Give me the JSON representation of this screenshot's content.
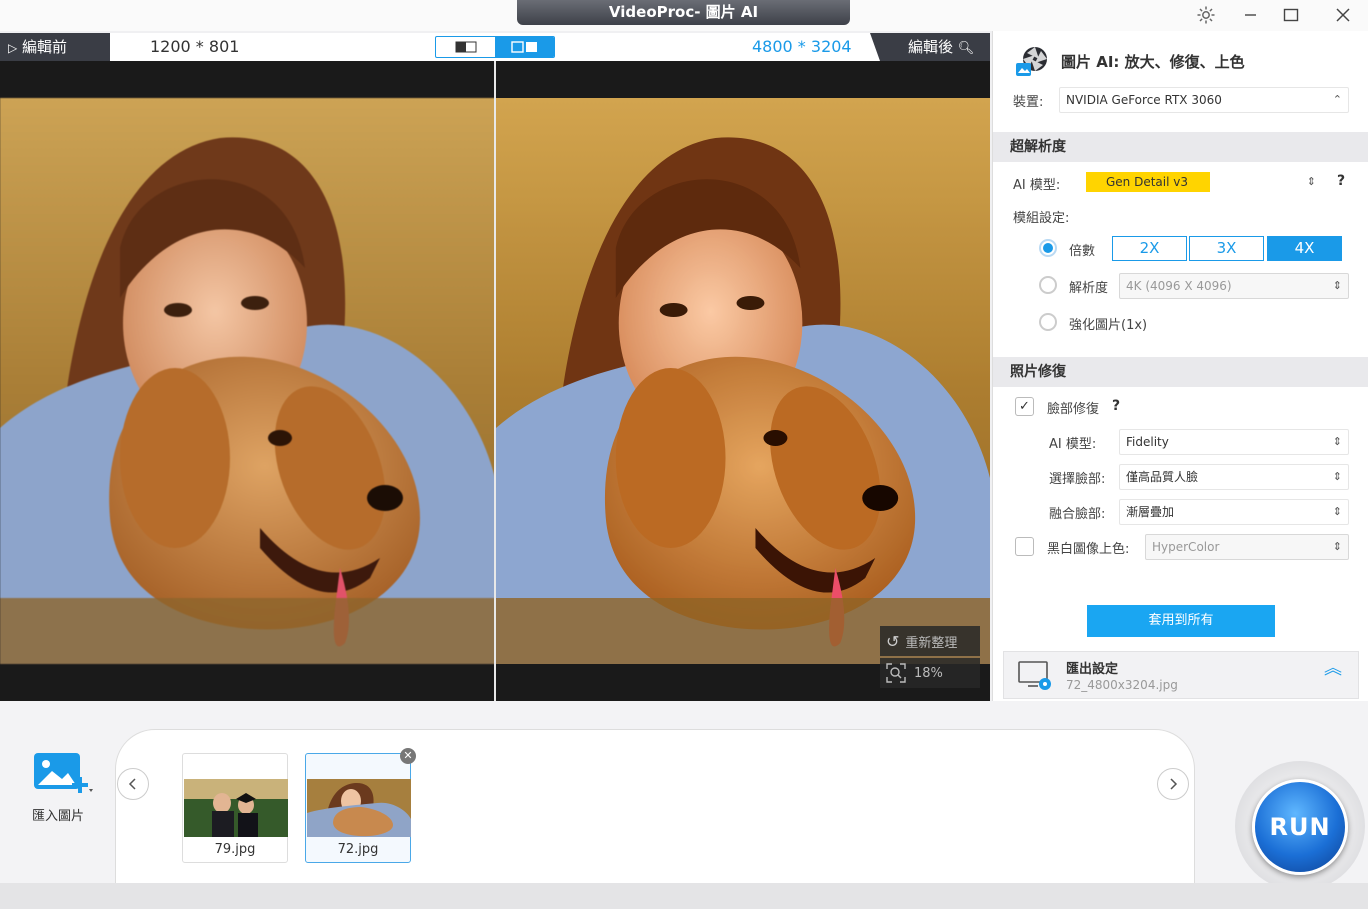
{
  "window": {
    "title": "VideoProc- 圖片 AI"
  },
  "compare": {
    "before_label": "編輯前",
    "after_label": "編輯後",
    "before_resolution": "1200 * 801",
    "after_resolution": "4800 * 3204",
    "reset_label": "重新整理",
    "zoom": "18%"
  },
  "panel": {
    "title": "圖片 AI: 放大、修復、上色",
    "device_label": "裝置:",
    "device_value": "NVIDIA GeForce RTX 3060",
    "super_resolution": {
      "header": "超解析度",
      "ai_model_label": "AI 模型:",
      "ai_model_value": "Gen Detail v3",
      "module_label": "模組設定:",
      "scale_label": "倍數",
      "scale_options": [
        "2X",
        "3X",
        "4X"
      ],
      "scale_selected": "4X",
      "resolution_label": "解析度",
      "resolution_value": "4K (4096 X 4096)",
      "enhance_label": "強化圖片(1x)"
    },
    "photo_repair": {
      "header": "照片修復",
      "face_repair_label": "臉部修復",
      "face_repair_checked": true,
      "ai_model_label": "AI 模型:",
      "ai_model_value": "Fidelity",
      "select_face_label": "選擇臉部:",
      "select_face_value": "僅高品質人臉",
      "blend_face_label": "融合臉部:",
      "blend_face_value": "漸層疊加",
      "colorize_label": "黑白圖像上色:",
      "colorize_checked": false,
      "colorize_value": "HyperColor"
    },
    "apply_all_label": "套用到所有",
    "export": {
      "title": "匯出設定",
      "filename": "72_4800x3204.jpg"
    }
  },
  "bottom": {
    "import_label": "匯入圖片",
    "thumbnails": [
      {
        "name": "79.jpg",
        "selected": false
      },
      {
        "name": "72.jpg",
        "selected": true
      }
    ],
    "run_label": "RUN"
  },
  "colors": {
    "accent": "#1a9ae8",
    "highlight_yellow": "#ffd400",
    "dark_tab": "#3a3d45"
  }
}
